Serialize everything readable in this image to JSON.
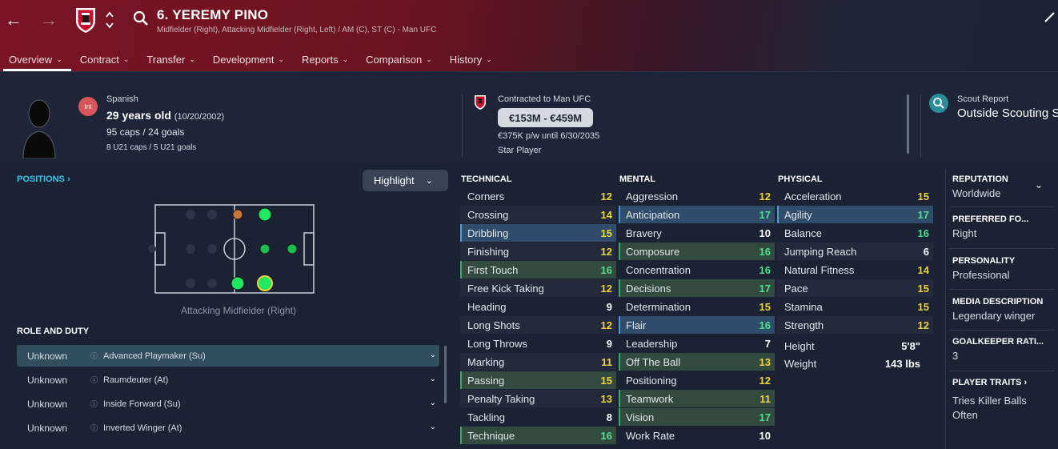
{
  "header": {
    "player_name": "6. YEREMY PINO",
    "subtitle": "Midfielder (Right), Attacking Midfielder (Right, Left) / AM (C), ST (C) - Man UFC"
  },
  "tabs": [
    {
      "label": "Overview"
    },
    {
      "label": "Contract"
    },
    {
      "label": "Transfer"
    },
    {
      "label": "Development"
    },
    {
      "label": "Reports"
    },
    {
      "label": "Comparison"
    },
    {
      "label": "History"
    }
  ],
  "info": {
    "int_badge": "Int",
    "nationality": "Spanish",
    "age": "29 years old",
    "dob": "(10/20/2002)",
    "caps": "95 caps / 24 goals",
    "u21": "8 U21 caps / 5 U21 goals",
    "contract": "Contracted to Man UFC",
    "value": "€153M - €459M",
    "wage": "€375K p/w until 6/30/2035",
    "status": "Star Player",
    "scout_label": "Scout Report",
    "scout_value": "Outside Scouting Scope"
  },
  "positions": {
    "header": "POSITIONS ›",
    "highlight": "Highlight",
    "position_label": "Attacking Midfielder (Right)"
  },
  "role": {
    "header": "ROLE AND DUTY",
    "rows": [
      {
        "duty": "Unknown",
        "role": "Advanced Playmaker (Su)"
      },
      {
        "duty": "Unknown",
        "role": "Raumdeuter (At)"
      },
      {
        "duty": "Unknown",
        "role": "Inside Forward (Su)"
      },
      {
        "duty": "Unknown",
        "role": "Inverted Winger (At)"
      }
    ]
  },
  "technical": {
    "title": "TECHNICAL",
    "attrs": [
      {
        "name": "Corners",
        "value": "12"
      },
      {
        "name": "Crossing",
        "value": "14"
      },
      {
        "name": "Dribbling",
        "value": "15"
      },
      {
        "name": "Finishing",
        "value": "12"
      },
      {
        "name": "First Touch",
        "value": "16"
      },
      {
        "name": "Free Kick Taking",
        "value": "12"
      },
      {
        "name": "Heading",
        "value": "9"
      },
      {
        "name": "Long Shots",
        "value": "12"
      },
      {
        "name": "Long Throws",
        "value": "9"
      },
      {
        "name": "Marking",
        "value": "11"
      },
      {
        "name": "Passing",
        "value": "15"
      },
      {
        "name": "Penalty Taking",
        "value": "13"
      },
      {
        "name": "Tackling",
        "value": "8"
      },
      {
        "name": "Technique",
        "value": "16"
      }
    ]
  },
  "mental": {
    "title": "MENTAL",
    "attrs": [
      {
        "name": "Aggression",
        "value": "12"
      },
      {
        "name": "Anticipation",
        "value": "17"
      },
      {
        "name": "Bravery",
        "value": "10"
      },
      {
        "name": "Composure",
        "value": "16"
      },
      {
        "name": "Concentration",
        "value": "16"
      },
      {
        "name": "Decisions",
        "value": "17"
      },
      {
        "name": "Determination",
        "value": "15"
      },
      {
        "name": "Flair",
        "value": "16"
      },
      {
        "name": "Leadership",
        "value": "7"
      },
      {
        "name": "Off The Ball",
        "value": "13"
      },
      {
        "name": "Positioning",
        "value": "12"
      },
      {
        "name": "Teamwork",
        "value": "11"
      },
      {
        "name": "Vision",
        "value": "17"
      },
      {
        "name": "Work Rate",
        "value": "10"
      }
    ]
  },
  "physical": {
    "title": "PHYSICAL",
    "attrs": [
      {
        "name": "Acceleration",
        "value": "15"
      },
      {
        "name": "Agility",
        "value": "17"
      },
      {
        "name": "Balance",
        "value": "16"
      },
      {
        "name": "Jumping Reach",
        "value": "6"
      },
      {
        "name": "Natural Fitness",
        "value": "14"
      },
      {
        "name": "Pace",
        "value": "15"
      },
      {
        "name": "Stamina",
        "value": "15"
      },
      {
        "name": "Strength",
        "value": "12"
      }
    ],
    "height_label": "Height",
    "height": "5'8\"",
    "weight_label": "Weight",
    "weight": "143 lbs"
  },
  "right_panel": {
    "reputation_title": "REPUTATION",
    "reputation": "Worldwide",
    "foot_title": "PREFERRED FO...",
    "foot": "Right",
    "personality_title": "PERSONALITY",
    "personality": "Professional",
    "media_title": "MEDIA DESCRIPTION",
    "media": "Legendary winger",
    "gk_title": "GOALKEEPER RATI...",
    "gk": "3",
    "traits_title": "PLAYER TRAITS ›",
    "traits": "Tries Killer Balls Often"
  },
  "colors": {
    "accent": "#34c6f0",
    "value_yellow": "#f0d23c",
    "value_green": "#4fe08a",
    "header_red": "#7a1525"
  }
}
